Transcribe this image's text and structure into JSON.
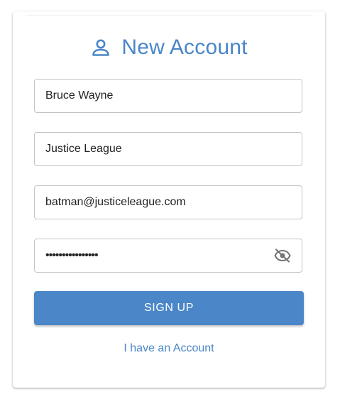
{
  "form": {
    "title": "New Account",
    "title_icon": "person-icon",
    "name_value": "Bruce Wayne",
    "team_value": "Justice League",
    "email_value": "batman@justiceleague.com",
    "password_masked": "••••••••••••••••",
    "password_toggle_icon": "eye-off-icon",
    "submit_label": "SIGN UP",
    "login_link": "I have an Account"
  },
  "colors": {
    "accent": "#4a86c8",
    "field_border": "#c4c4c4",
    "icon_gray": "#757575"
  }
}
